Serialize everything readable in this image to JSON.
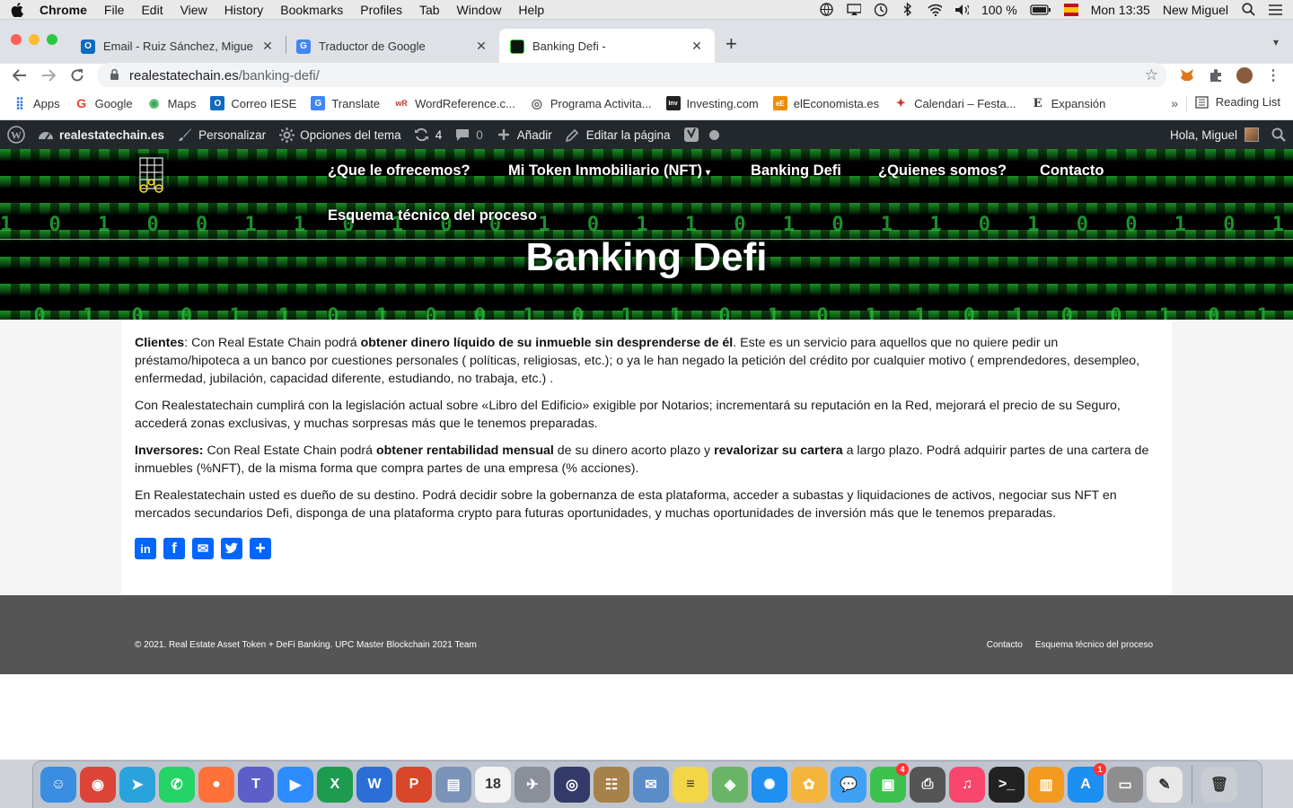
{
  "menubar": {
    "app": "Chrome",
    "items": [
      "File",
      "Edit",
      "View",
      "History",
      "Bookmarks",
      "Profiles",
      "Tab",
      "Window",
      "Help"
    ],
    "battery": "100 %",
    "clock": "Mon 13:35",
    "user": "New Miguel"
  },
  "tabs": [
    {
      "title": "Email - Ruiz Sánchez, Miguel -",
      "icon": "outlook-icon",
      "color": "#0f6cbd"
    },
    {
      "title": "Traductor de Google",
      "icon": "google-translate-icon",
      "color": "#4285f4"
    },
    {
      "title": "Banking Defi -",
      "icon": "site-favicon",
      "color": "#111111"
    }
  ],
  "address": {
    "domain": "realestatechain.es",
    "path": "/banking-defi/"
  },
  "bookmarks": [
    {
      "label": "Apps",
      "icon": "apps-grid-icon",
      "color": "#1a73e8",
      "glyph": "⣿"
    },
    {
      "label": "Google",
      "icon": "google-icon",
      "color": "#ea4335",
      "glyph": "G"
    },
    {
      "label": "Maps",
      "icon": "maps-pin-icon",
      "color": "#34a853",
      "glyph": "◉"
    },
    {
      "label": "Correo IESE",
      "icon": "outlook-icon",
      "color": "#0f6cbd",
      "glyph": "O"
    },
    {
      "label": "Translate",
      "icon": "translate-icon",
      "color": "#4285f4",
      "glyph": "G"
    },
    {
      "label": "WordReference.c...",
      "icon": "wordreference-icon",
      "color": "#c0392b",
      "glyph": "wR"
    },
    {
      "label": "Programa Activita...",
      "icon": "program-icon",
      "color": "#666666",
      "glyph": "◎"
    },
    {
      "label": "Investing.com",
      "icon": "investing-icon",
      "color": "#222222",
      "glyph": "Inv"
    },
    {
      "label": "elEconomista.es",
      "icon": "eleconomista-icon",
      "color": "#f08c00",
      "glyph": "eE"
    },
    {
      "label": "Calendari – Festa...",
      "icon": "calendar-icon",
      "color": "#d93025",
      "glyph": "✦"
    },
    {
      "label": "Expansión",
      "icon": "expansion-icon",
      "color": "#333333",
      "glyph": "E"
    }
  ],
  "reading_list": "Reading List",
  "wpbar": {
    "site": "realestatechain.es",
    "customize": "Personalizar",
    "theme_options": "Opciones del tema",
    "updates": "4",
    "comments": "0",
    "add": "Añadir",
    "edit": "Editar la página",
    "greeting": "Hola, Miguel"
  },
  "nav": {
    "items": [
      "¿Que le ofrecemos?",
      "Mi Token Inmobiliario (NFT)",
      "Banking Defi",
      "¿Quienes somos?",
      "Contacto",
      "Esquema técnico del proceso"
    ]
  },
  "hero": {
    "title": "Banking Defi",
    "matrix": "1 0 1 0 0 1 1 0 1 0 0 1 0 1 1 0 1 0 1 1 0 1 0 0 1 0 1 1 0 1 0 1 0 0 1 1 0 1 0 1 0 1 1 0 1 0 0 1 0 1 1 0 1 0 1 1 0 1 0 0 1 0 1 1 0 1 0 1 0 0 1 1 0 1 0 1"
  },
  "content": {
    "p1_lead": "Clientes",
    "p1_a": ": Con Real Estate Chain podrá ",
    "p1_bold": "obtener dinero líquido de su inmueble sin desprenderse de él",
    "p1_b": ". Este es un servicio para aquellos que no quiere pedir un préstamo/hipoteca a un banco por cuestiones personales ( políticas, religiosas, etc.); o ya le han negado la petición del crédito por cualquier motivo ( emprendedores, desempleo, enfermedad, jubilación, capacidad diferente, estudiando, no trabaja, etc.) .",
    "p2": "Con Realestatechain cumplirá con la legislación actual sobre «Libro del Edificio» exigible por Notarios; incrementará su reputación en la Red, mejorará el precio de su Seguro, accederá zonas exclusivas, y muchas sorpresas más que le tenemos preparadas.",
    "p3_lead": "Inversores:",
    "p3_a": " Con Real Estate Chain podrá ",
    "p3_bold1": "obtener rentabilidad mensual",
    "p3_b": " de su dinero acorto plazo y ",
    "p3_bold2": "revalorizar su cartera",
    "p3_c": " a largo plazo. Podrá adquirir partes de una cartera de inmuebles (%NFT), de la misma forma que compra partes de una empresa (% acciones).",
    "p4": "En Realestatechain usted es dueño de su destino. Podrá decidir sobre la gobernanza de esta plataforma, acceder a subastas y liquidaciones de activos, negociar sus NFT en mercados secundarios Defi, disponga de una plataforma crypto para futuras oportunidades, y muchas oportunidades de inversión más que le tenemos preparadas."
  },
  "share": [
    {
      "name": "linkedin-share-icon",
      "glyph": "in"
    },
    {
      "name": "facebook-share-icon",
      "glyph": "f"
    },
    {
      "name": "email-share-icon",
      "glyph": "✉"
    },
    {
      "name": "twitter-share-icon",
      "glyph": "🐦"
    },
    {
      "name": "more-share-icon",
      "glyph": "+"
    }
  ],
  "footer": {
    "copyright": "© 2021. Real Estate Asset Token + DeFi Banking. UPC Master Blockchain 2021 Team",
    "links": [
      "Contacto",
      "Esquema técnico del proceso"
    ]
  },
  "dock": [
    {
      "name": "finder-icon",
      "color": "#3a8de0",
      "glyph": "☺"
    },
    {
      "name": "chrome-icon",
      "color": "#db4437",
      "glyph": "◉"
    },
    {
      "name": "telegram-icon",
      "color": "#2aa3dc",
      "glyph": "➤"
    },
    {
      "name": "whatsapp-icon",
      "color": "#25d366",
      "glyph": "✆"
    },
    {
      "name": "firefox-icon",
      "color": "#ff7139",
      "glyph": "●"
    },
    {
      "name": "teams-icon",
      "color": "#5b5fc7",
      "glyph": "T"
    },
    {
      "name": "zoom-icon",
      "color": "#2d8cff",
      "glyph": "▶"
    },
    {
      "name": "excel-icon",
      "color": "#1d9b4f",
      "glyph": "X"
    },
    {
      "name": "word-icon",
      "color": "#2b6fd6",
      "glyph": "W"
    },
    {
      "name": "powerpoint-icon",
      "color": "#d9472b",
      "glyph": "P"
    },
    {
      "name": "preview-icon",
      "color": "#7c93b8",
      "glyph": "▤"
    },
    {
      "name": "calendar-icon",
      "color": "#f4f4f4",
      "glyph": "18"
    },
    {
      "name": "launchpad-icon",
      "color": "#8a8f99",
      "glyph": "✈"
    },
    {
      "name": "siri-icon",
      "color": "#333a6a",
      "glyph": "◎"
    },
    {
      "name": "notes-brown-icon",
      "color": "#a7814a",
      "glyph": "☷"
    },
    {
      "name": "mail-stamp-icon",
      "color": "#5a8cc8",
      "glyph": "✉"
    },
    {
      "name": "notes-icon",
      "color": "#f3d548",
      "glyph": "≡"
    },
    {
      "name": "maps-icon",
      "color": "#69b466",
      "glyph": "◈"
    },
    {
      "name": "safari-icon",
      "color": "#1f8ff0",
      "glyph": "✺"
    },
    {
      "name": "photos-icon",
      "color": "#f5b43a",
      "glyph": "✿"
    },
    {
      "name": "messages-icon",
      "color": "#3fa1f5",
      "glyph": "💬"
    },
    {
      "name": "facetime-icon",
      "color": "#3cc14e",
      "glyph": "▣",
      "badge": "4"
    },
    {
      "name": "printer-icon",
      "color": "#555555",
      "glyph": "⎙"
    },
    {
      "name": "music-icon",
      "color": "#f8466c",
      "glyph": "♫"
    },
    {
      "name": "terminal-icon",
      "color": "#222222",
      "glyph": ">_"
    },
    {
      "name": "books-icon",
      "color": "#f39a1e",
      "glyph": "▥"
    },
    {
      "name": "appstore-icon",
      "color": "#1d8ff0",
      "glyph": "A",
      "badge": "1"
    },
    {
      "name": "scanner-icon",
      "color": "#8e8e8e",
      "glyph": "▭"
    },
    {
      "name": "textedit-icon",
      "color": "#e8e8e8",
      "glyph": "✎"
    },
    {
      "name": "trash-icon",
      "color": "#c9ccd1",
      "glyph": "🗑"
    }
  ]
}
